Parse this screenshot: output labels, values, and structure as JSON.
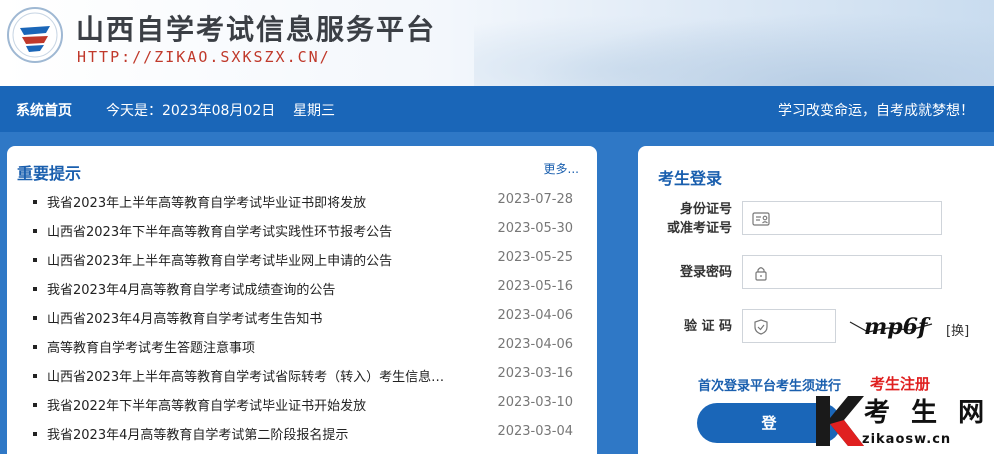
{
  "header": {
    "title": "山西自学考试信息服务平台",
    "url": "HTTP://ZIKAO.SXKSZX.CN/"
  },
  "nav": {
    "home": "系统首页",
    "today": "今天是：2023年08月02日    星期三",
    "slogan": "学习改变命运，自考成就梦想！"
  },
  "notices": {
    "title": "重要提示",
    "more": "更多...",
    "items": [
      {
        "title": "我省2023年上半年高等教育自学考试毕业证书即将发放",
        "date": "2023-07-28"
      },
      {
        "title": "山西省2023年下半年高等教育自学考试实践性环节报考公告",
        "date": "2023-05-30"
      },
      {
        "title": "山西省2023年上半年高等教育自学考试毕业网上申请的公告",
        "date": "2023-05-25"
      },
      {
        "title": "我省2023年4月高等教育自学考试成绩查询的公告",
        "date": "2023-05-16"
      },
      {
        "title": "山西省2023年4月高等教育自学考试考生告知书",
        "date": "2023-04-06"
      },
      {
        "title": "高等教育自学考试考生答题注意事项",
        "date": "2023-04-06"
      },
      {
        "title": "山西省2023年上半年高等教育自学考试省际转考（转入）考生信息…",
        "date": "2023-03-16"
      },
      {
        "title": "我省2022年下半年高等教育自学考试毕业证书开始发放",
        "date": "2023-03-10"
      },
      {
        "title": "我省2023年4月高等教育自学考试第二阶段报名提示",
        "date": "2023-03-04"
      }
    ]
  },
  "login": {
    "title": "考生登录",
    "id_label_1": "身份证号",
    "id_label_2": "或准考证号",
    "password_label": "登录密码",
    "captcha_label": "验 证 码",
    "captcha_text": "mp6f",
    "swap": "[换]",
    "hint": "首次登录平台考生须进行",
    "register": "考生注册",
    "submit": "登",
    "icons": {
      "id": "id-card-icon",
      "password": "lock-icon",
      "captcha": "shield-icon"
    }
  },
  "watermark": {
    "brand": "考 生 网",
    "domain": "zikaosw.cn"
  },
  "colors": {
    "primary": "#1a66b8",
    "accent_red": "#e02020",
    "header_url": "#c0392b"
  }
}
